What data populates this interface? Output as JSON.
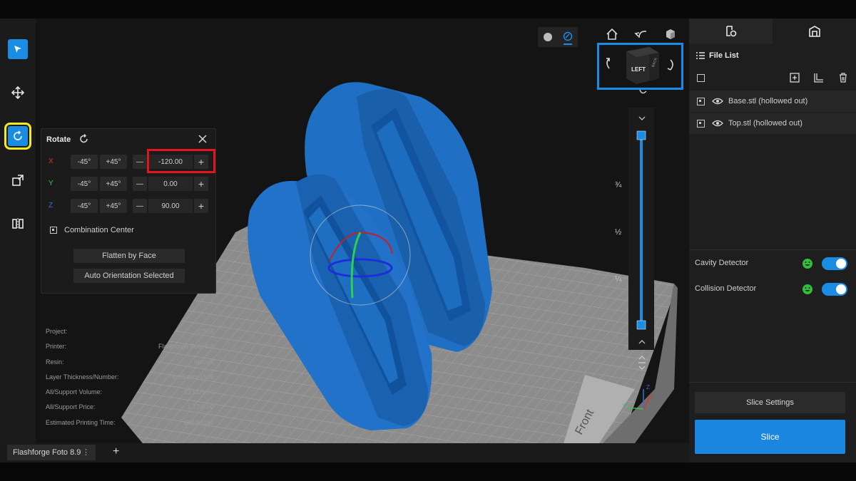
{
  "left_toolbar": {
    "tools": [
      {
        "name": "select-tool",
        "icon": "cursor-arrow-icon",
        "active": true
      },
      {
        "name": "move-tool",
        "icon": "move-arrows-icon"
      },
      {
        "name": "rotate-tool",
        "icon": "rotate-icon",
        "active": true
      },
      {
        "name": "scale-tool",
        "icon": "scale-icon"
      },
      {
        "name": "mirror-tool",
        "icon": "mirror-icon"
      }
    ]
  },
  "rotate_panel": {
    "title": "Rotate",
    "rows": [
      {
        "axis": "X",
        "color": "#d8362e",
        "minus_label": "-45°",
        "plus_label": "+45°",
        "value": "-120.00"
      },
      {
        "axis": "Y",
        "color": "#3fbf4a",
        "minus_label": "-45°",
        "plus_label": "+45°",
        "value": "0.00"
      },
      {
        "axis": "Z",
        "color": "#3b6bd9",
        "minus_label": "-45°",
        "plus_label": "+45°",
        "value": "90.00"
      }
    ],
    "decrement_symbol": "—",
    "increment_symbol": "+",
    "combination_center_label": "Combination Center",
    "flatten_label": "Flatten by Face",
    "auto_orient_label": "Auto Orientation Selected"
  },
  "project_info": [
    {
      "key": "Project:",
      "value": "11568"
    },
    {
      "key": "Printer:",
      "value": "Flashforge Foto 8.9"
    },
    {
      "key": "Resin:",
      "value": "normal"
    },
    {
      "key": "Layer Thickness/Number:",
      "value": "0.05 mm/1506"
    },
    {
      "key": "All/Support Volume:",
      "value": "53.61/0.00"
    },
    {
      "key": "All/Support Price:",
      "value": "1.77/0.00"
    },
    {
      "key": "Estimated Printing Time:",
      "value": "6h10m16s"
    }
  ],
  "view": {
    "cube_face_label": "LEFT",
    "cube_side_label": "BACK",
    "plate_label": "Front",
    "slider_ticks": [
      "¾",
      "½",
      "¼"
    ],
    "axis_labels": {
      "x": "X",
      "y": "Y",
      "z": "Z"
    }
  },
  "right_panel": {
    "file_list_title": "File List",
    "files": [
      {
        "name": "Base.stl (hollowed out)"
      },
      {
        "name": "Top.stl (hollowed out)"
      }
    ],
    "detectors": [
      {
        "label": "Cavity Detector",
        "enabled": true
      },
      {
        "label": "Collision Detector",
        "enabled": true
      }
    ],
    "slice_settings_label": "Slice Settings",
    "slice_label": "Slice"
  },
  "bottom_tabs": {
    "project_tab": "Flashforge Foto 8.9",
    "more_symbol": "⋮",
    "add_symbol": "+"
  },
  "colors": {
    "accent": "#1a8ce3",
    "model_blue": "#1c6fc4",
    "highlight_red": "#e3151c",
    "highlight_yellow": "#f4ec1c",
    "detector_ok": "#2fbf3a"
  }
}
